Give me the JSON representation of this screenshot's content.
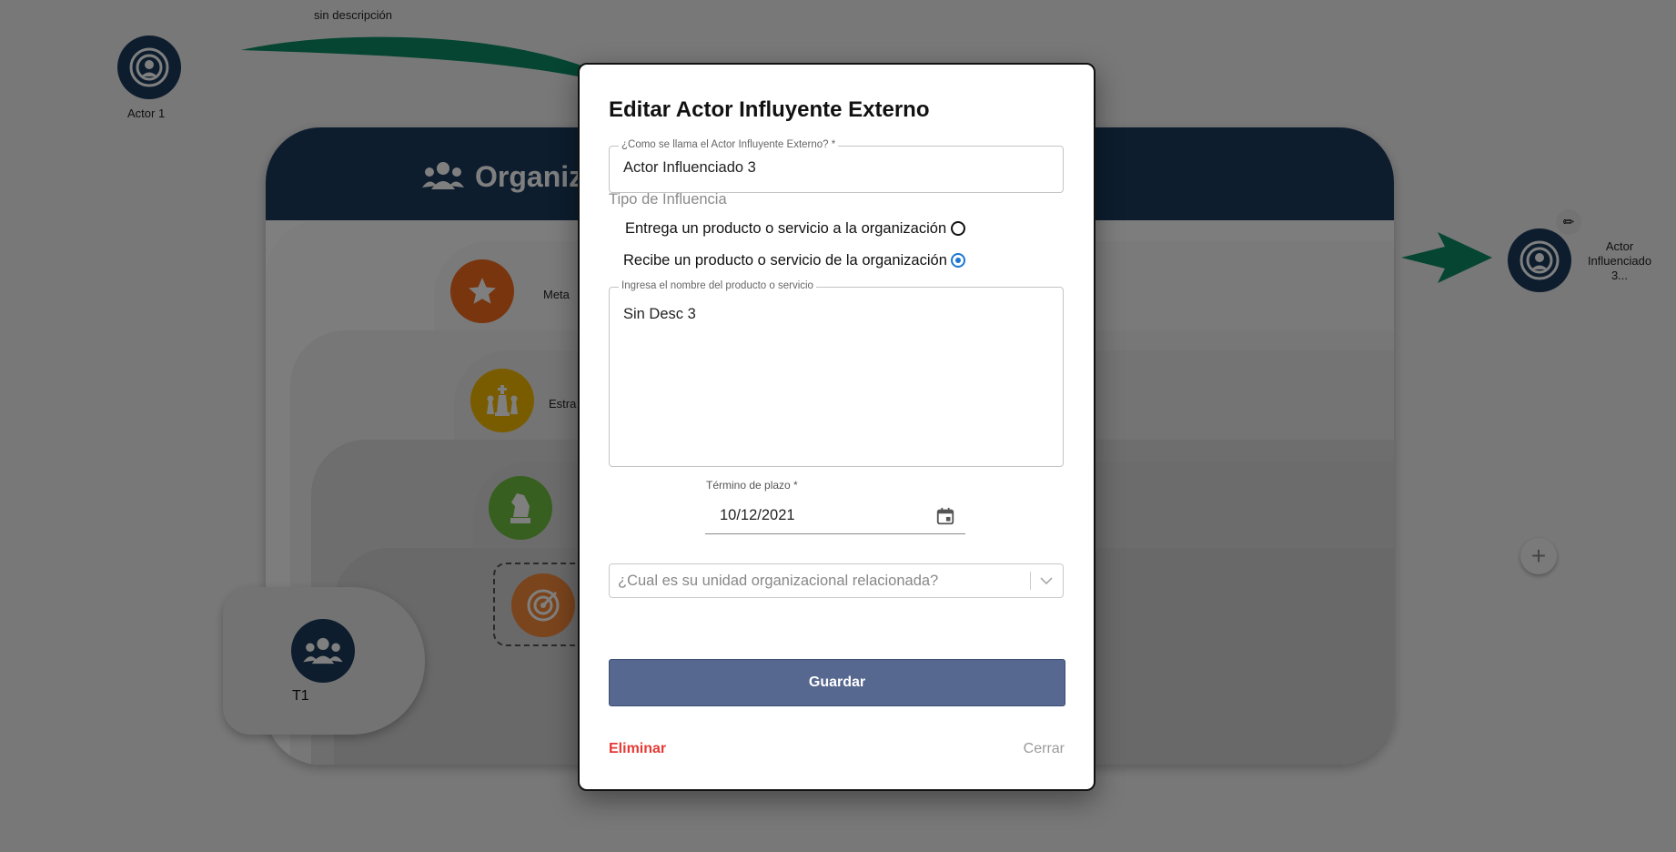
{
  "background": {
    "top_caption": "sin descripción",
    "actor1_label": "Actor 1",
    "actor3_label_lines": [
      "Actor",
      "Influenciado",
      "3..."
    ],
    "org_title": "Organiz",
    "levels": [
      {
        "label": "Meta",
        "color": "#f26b1d"
      },
      {
        "label": "Estra",
        "color": "#f5b800"
      },
      {
        "label": "",
        "color": "#6fbf3f"
      },
      {
        "label": "",
        "color": "#f5893a"
      }
    ],
    "t1_label": "T1",
    "arrow_color": "#0a8a63",
    "brand_color": "#1b3a5c"
  },
  "modal": {
    "title": "Editar Actor Influyente Externo",
    "name_field": {
      "label": "¿Como se llama el Actor Influyente Externo? *",
      "value": "Actor Influenciado 3"
    },
    "influence_section": {
      "label": "Tipo de Influencia",
      "options": [
        {
          "label": "Entrega un producto o servicio a la organización",
          "selected": false
        },
        {
          "label": "Recibe un producto o servicio de la organización",
          "selected": true
        }
      ]
    },
    "product_field": {
      "label": "Ingresa el nombre del producto o servicio",
      "value": "Sin Desc 3"
    },
    "date_field": {
      "label": "Término de plazo *",
      "value": "10/12/2021"
    },
    "unit_select": {
      "placeholder": "¿Cual es su unidad organizacional relacionada?"
    },
    "save_label": "Guardar",
    "delete_label": "Eliminar",
    "close_label": "Cerrar",
    "accent_color": "#566790"
  }
}
